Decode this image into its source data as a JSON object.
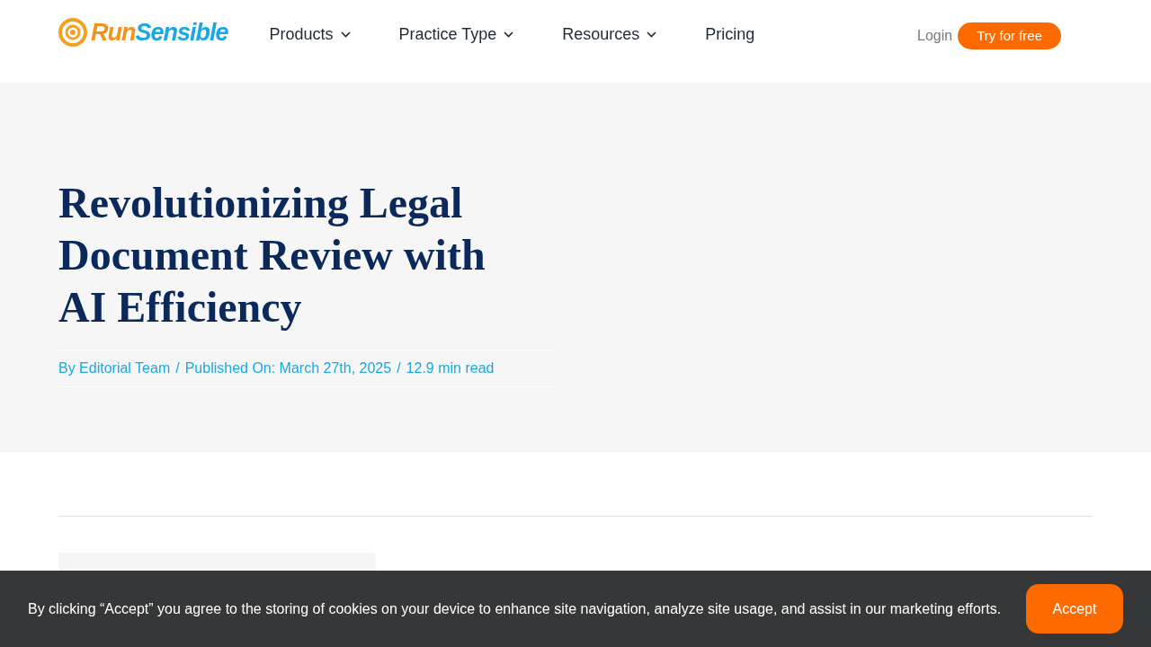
{
  "header": {
    "logo": {
      "part_1": "Run",
      "part_2": "Sensible"
    },
    "nav": [
      {
        "label": "Products",
        "dropdown": true
      },
      {
        "label": "Practice Type",
        "dropdown": true
      },
      {
        "label": "Resources",
        "dropdown": true
      },
      {
        "label": "Pricing",
        "dropdown": false
      }
    ],
    "login": "Login",
    "cta": "Try for free"
  },
  "hero": {
    "title": "Revolutionizing Legal Document Review with AI Efficiency",
    "meta": [
      "By Editorial Team",
      "Published On: March 27th, 2025",
      "12.9 min read"
    ],
    "separator": "/"
  },
  "cookie_banner": {
    "text": "By clicking “Accept” you agree to the storing of cookies on your device to enhance site navigation, analyze site usage, and assist in our marketing efforts.",
    "button": "Accept"
  }
}
